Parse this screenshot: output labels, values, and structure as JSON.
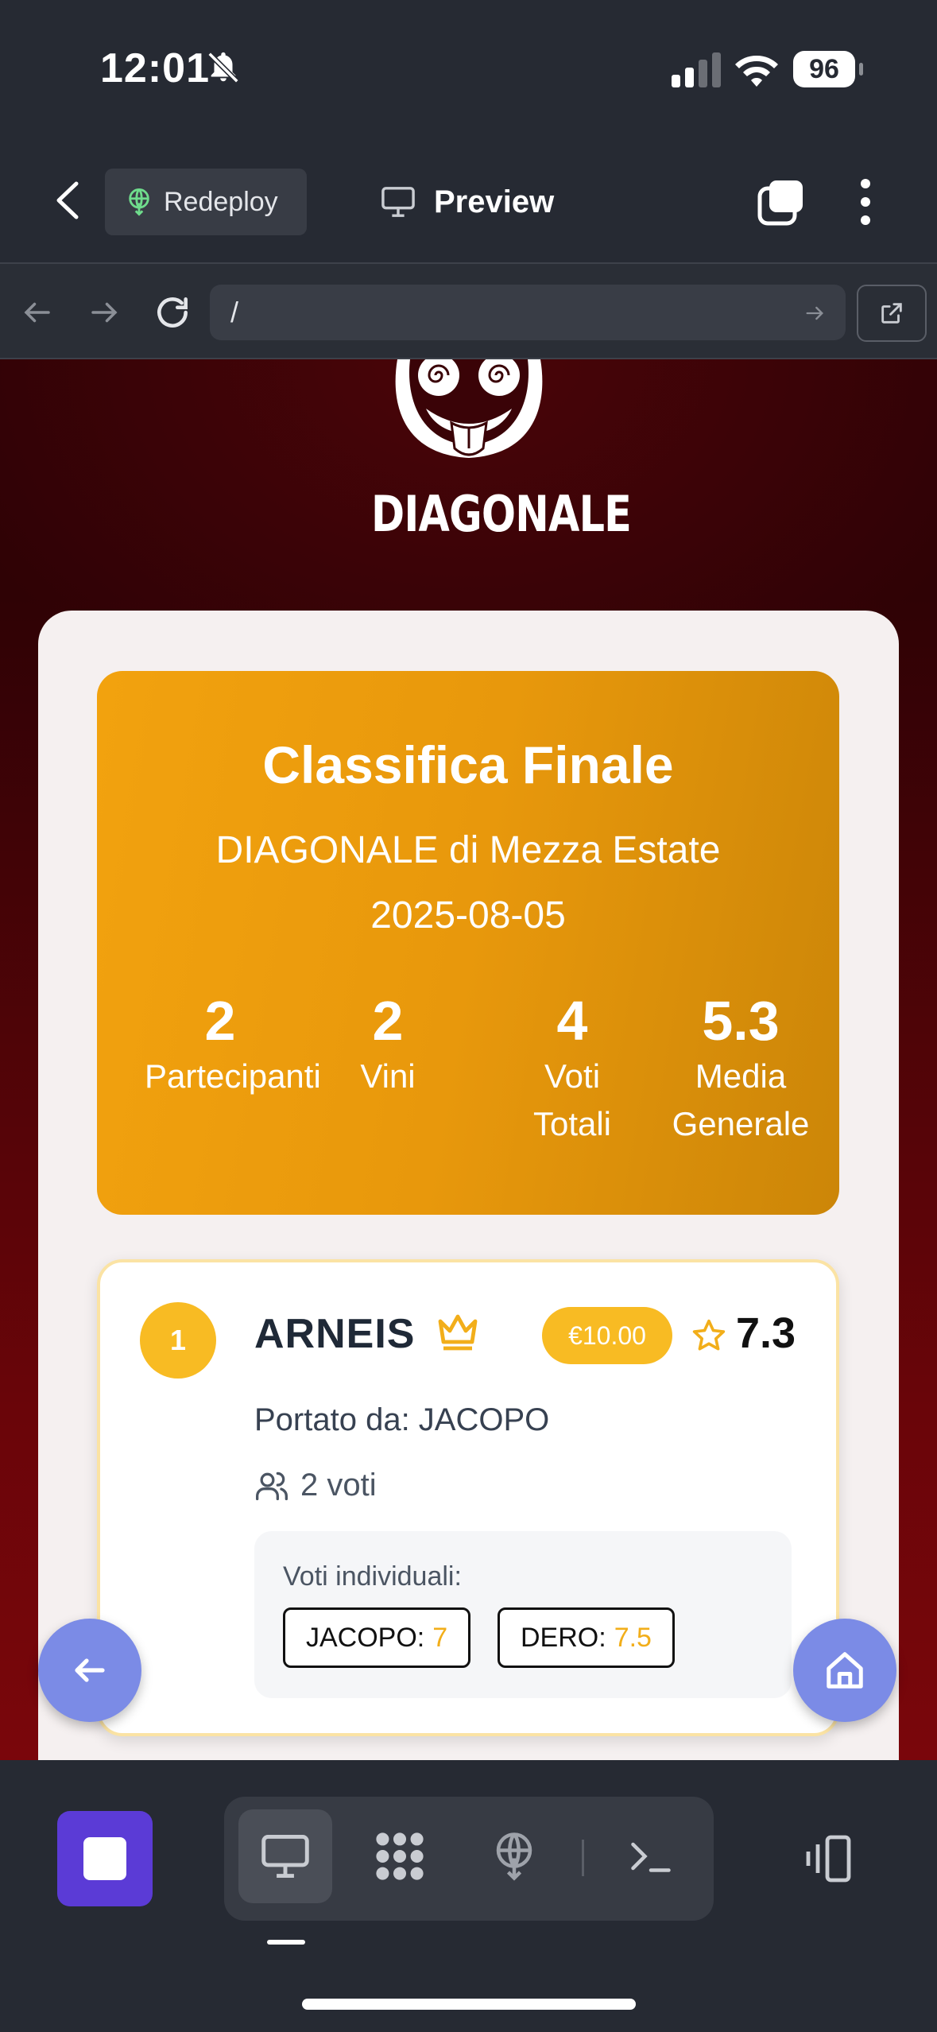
{
  "status_bar": {
    "time": "12:01",
    "battery": "96"
  },
  "header": {
    "redeploy_label": "Redeploy",
    "preview_label": "Preview"
  },
  "url_bar": {
    "url": "/"
  },
  "site": {
    "logo_text": "DIAGONALE",
    "hero": {
      "title": "Classifica Finale",
      "event": "DIAGONALE di Mezza Estate",
      "date": "2025-08-05",
      "stats": [
        {
          "value": "2",
          "label_line1": "Partecipanti",
          "label_line2": ""
        },
        {
          "value": "2",
          "label_line1": "Vini",
          "label_line2": ""
        },
        {
          "value": "4",
          "label_line1": "Voti",
          "label_line2": "Totali"
        },
        {
          "value": "5.3",
          "label_line1": "Media",
          "label_line2": "Generale"
        }
      ]
    },
    "ranking": [
      {
        "rank": "1",
        "name": "ARNEIS",
        "price": "€10.00",
        "score": "7.3",
        "brought_by": "Portato da: JACOPO",
        "votes": "2 voti",
        "individual_label": "Voti individuali:",
        "individual_votes": [
          {
            "voter": "JACOPO:",
            "vote": "7"
          },
          {
            "voter": "DERO:",
            "vote": "7.5"
          }
        ]
      }
    ]
  },
  "colors": {
    "accent_gold": "#f2a20e",
    "rank_badge": "#f8bb23",
    "fab": "#7b8be6",
    "stop_button": "#5b3bd6",
    "background_red": "#6a0509"
  }
}
